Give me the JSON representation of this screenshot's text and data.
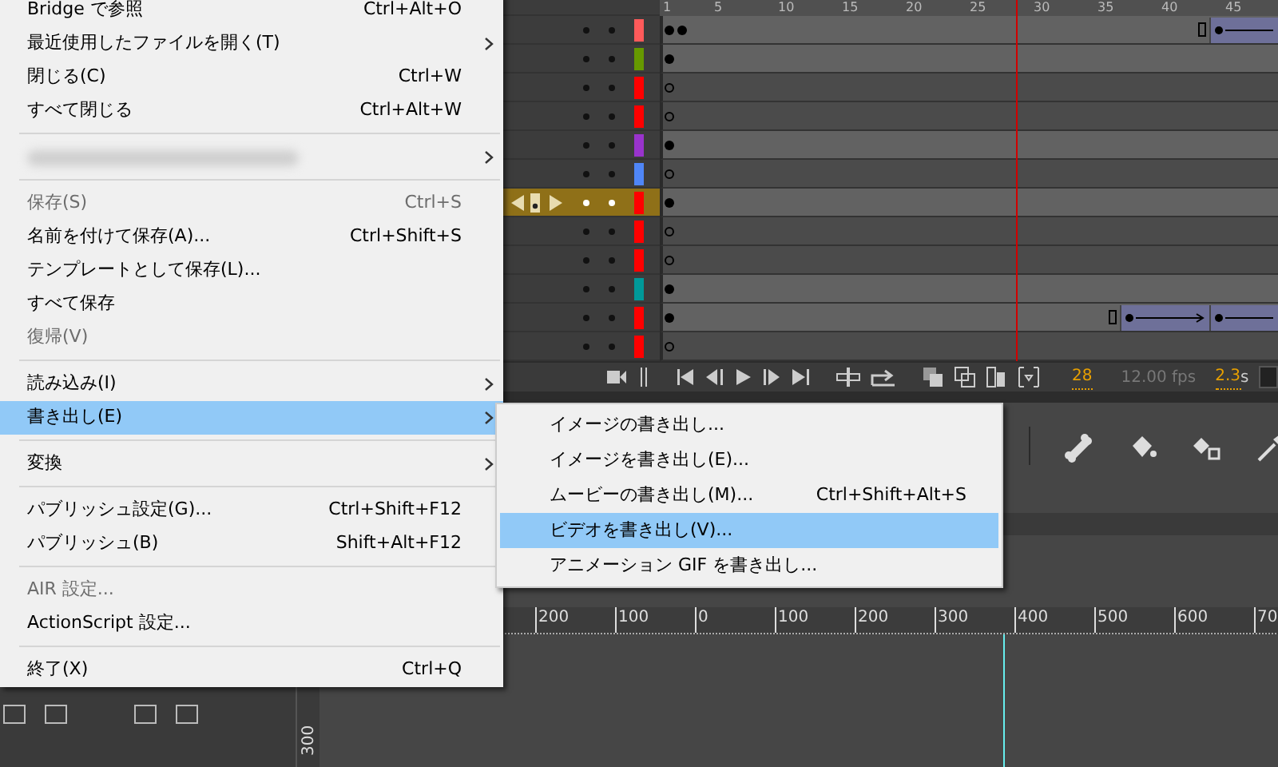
{
  "file_menu": {
    "items": [
      {
        "kind": "item",
        "label": "Bridge で参照",
        "shortcut": "Ctrl+Alt+O",
        "submenu": false,
        "disabled": false,
        "selected": false
      },
      {
        "kind": "item",
        "label": "最近使用したファイルを開く(T)",
        "submenu": true,
        "disabled": false,
        "selected": false
      },
      {
        "kind": "item",
        "label": "閉じる(C)",
        "shortcut": "Ctrl+W",
        "submenu": false,
        "disabled": false,
        "selected": false
      },
      {
        "kind": "item",
        "label": "すべて閉じる",
        "shortcut": "Ctrl+Alt+W",
        "submenu": false,
        "disabled": false,
        "selected": false
      },
      {
        "kind": "separator"
      },
      {
        "kind": "redacted",
        "submenu": true,
        "disabled": false,
        "selected": false
      },
      {
        "kind": "separator"
      },
      {
        "kind": "item",
        "label": "保存(S)",
        "shortcut": "Ctrl+S",
        "submenu": false,
        "disabled": true,
        "selected": false
      },
      {
        "kind": "item",
        "label": "名前を付けて保存(A)...",
        "shortcut": "Ctrl+Shift+S",
        "submenu": false,
        "disabled": false,
        "selected": false
      },
      {
        "kind": "item",
        "label": "テンプレートとして保存(L)...",
        "submenu": false,
        "disabled": false,
        "selected": false
      },
      {
        "kind": "item",
        "label": "すべて保存",
        "submenu": false,
        "disabled": false,
        "selected": false
      },
      {
        "kind": "item",
        "label": "復帰(V)",
        "submenu": false,
        "disabled": true,
        "selected": false
      },
      {
        "kind": "separator"
      },
      {
        "kind": "item",
        "label": "読み込み(I)",
        "submenu": true,
        "disabled": false,
        "selected": false
      },
      {
        "kind": "item",
        "label": "書き出し(E)",
        "submenu": true,
        "disabled": false,
        "selected": true
      },
      {
        "kind": "separator"
      },
      {
        "kind": "item",
        "label": "変換",
        "submenu": true,
        "disabled": false,
        "selected": false
      },
      {
        "kind": "separator"
      },
      {
        "kind": "item",
        "label": "パブリッシュ設定(G)...",
        "shortcut": "Ctrl+Shift+F12",
        "submenu": false,
        "disabled": false,
        "selected": false
      },
      {
        "kind": "item",
        "label": "パブリッシュ(B)",
        "shortcut": "Shift+Alt+F12",
        "submenu": false,
        "disabled": false,
        "selected": false
      },
      {
        "kind": "separator"
      },
      {
        "kind": "item",
        "label": "AIR 設定...",
        "submenu": false,
        "disabled": true,
        "selected": false
      },
      {
        "kind": "item",
        "label": "ActionScript 設定...",
        "submenu": false,
        "disabled": false,
        "selected": false
      },
      {
        "kind": "separator"
      },
      {
        "kind": "item",
        "label": "終了(X)",
        "shortcut": "Ctrl+Q",
        "submenu": false,
        "disabled": false,
        "selected": false
      }
    ]
  },
  "export_submenu": {
    "items": [
      {
        "label": "イメージの書き出し...",
        "selected": false
      },
      {
        "label": "イメージを書き出し(E)...",
        "selected": false
      },
      {
        "label": "ムービーの書き出し(M)...",
        "shortcut": "Ctrl+Shift+Alt+S",
        "selected": false
      },
      {
        "label": "ビデオを書き出し(V)...",
        "selected": true
      },
      {
        "label": "アニメーション GIF を書き出し...",
        "selected": false
      }
    ]
  },
  "timeline": {
    "frame_numbers": [
      "1",
      "5",
      "10",
      "15",
      "20",
      "25",
      "30",
      "35",
      "40",
      "45"
    ],
    "layers": [
      {
        "color": "#ff5a5a",
        "selected": false,
        "keyframes": [
          {
            "filled": true
          },
          {
            "filled": true
          }
        ],
        "tweens": [
          {
            "kind": "open"
          }
        ]
      },
      {
        "color": "#669900",
        "selected": false,
        "keyframes": [
          {
            "filled": true
          }
        ]
      },
      {
        "color": "#ff0000",
        "selected": false,
        "keyframes": [
          {
            "filled": false
          }
        ]
      },
      {
        "color": "#ff0000",
        "selected": false,
        "keyframes": [
          {
            "filled": false
          }
        ]
      },
      {
        "color": "#9933cc",
        "selected": false,
        "keyframes": [
          {
            "filled": true
          }
        ]
      },
      {
        "color": "#4f86f7",
        "selected": false,
        "keyframes": [
          {
            "filled": false
          }
        ]
      },
      {
        "color": "#ff0000",
        "selected": true,
        "keyframes": [
          {
            "filled": true
          }
        ]
      },
      {
        "color": "#ff0000",
        "selected": false,
        "keyframes": [
          {
            "filled": false
          }
        ]
      },
      {
        "color": "#ff0000",
        "selected": false,
        "keyframes": [
          {
            "filled": false
          }
        ]
      },
      {
        "color": "#009999",
        "selected": false,
        "keyframes": [
          {
            "filled": true
          }
        ]
      },
      {
        "color": "#ff0000",
        "selected": false,
        "keyframes": [
          {
            "filled": true
          }
        ],
        "tweens": [
          {
            "kind": "closed"
          },
          {
            "kind": "open"
          }
        ]
      },
      {
        "color": "#ff0000",
        "selected": false,
        "keyframes": [
          {
            "filled": false
          }
        ]
      }
    ],
    "toolbar": {
      "current_frame": "28",
      "frame_rate": "12.00 fps",
      "elapsed": "2.3",
      "elapsed_unit": "s"
    }
  },
  "stage": {
    "h_ruler_labels": [
      "200",
      "100",
      "0",
      "100",
      "200",
      "300",
      "400",
      "500",
      "600",
      "70"
    ],
    "v_ruler_label": "300"
  }
}
